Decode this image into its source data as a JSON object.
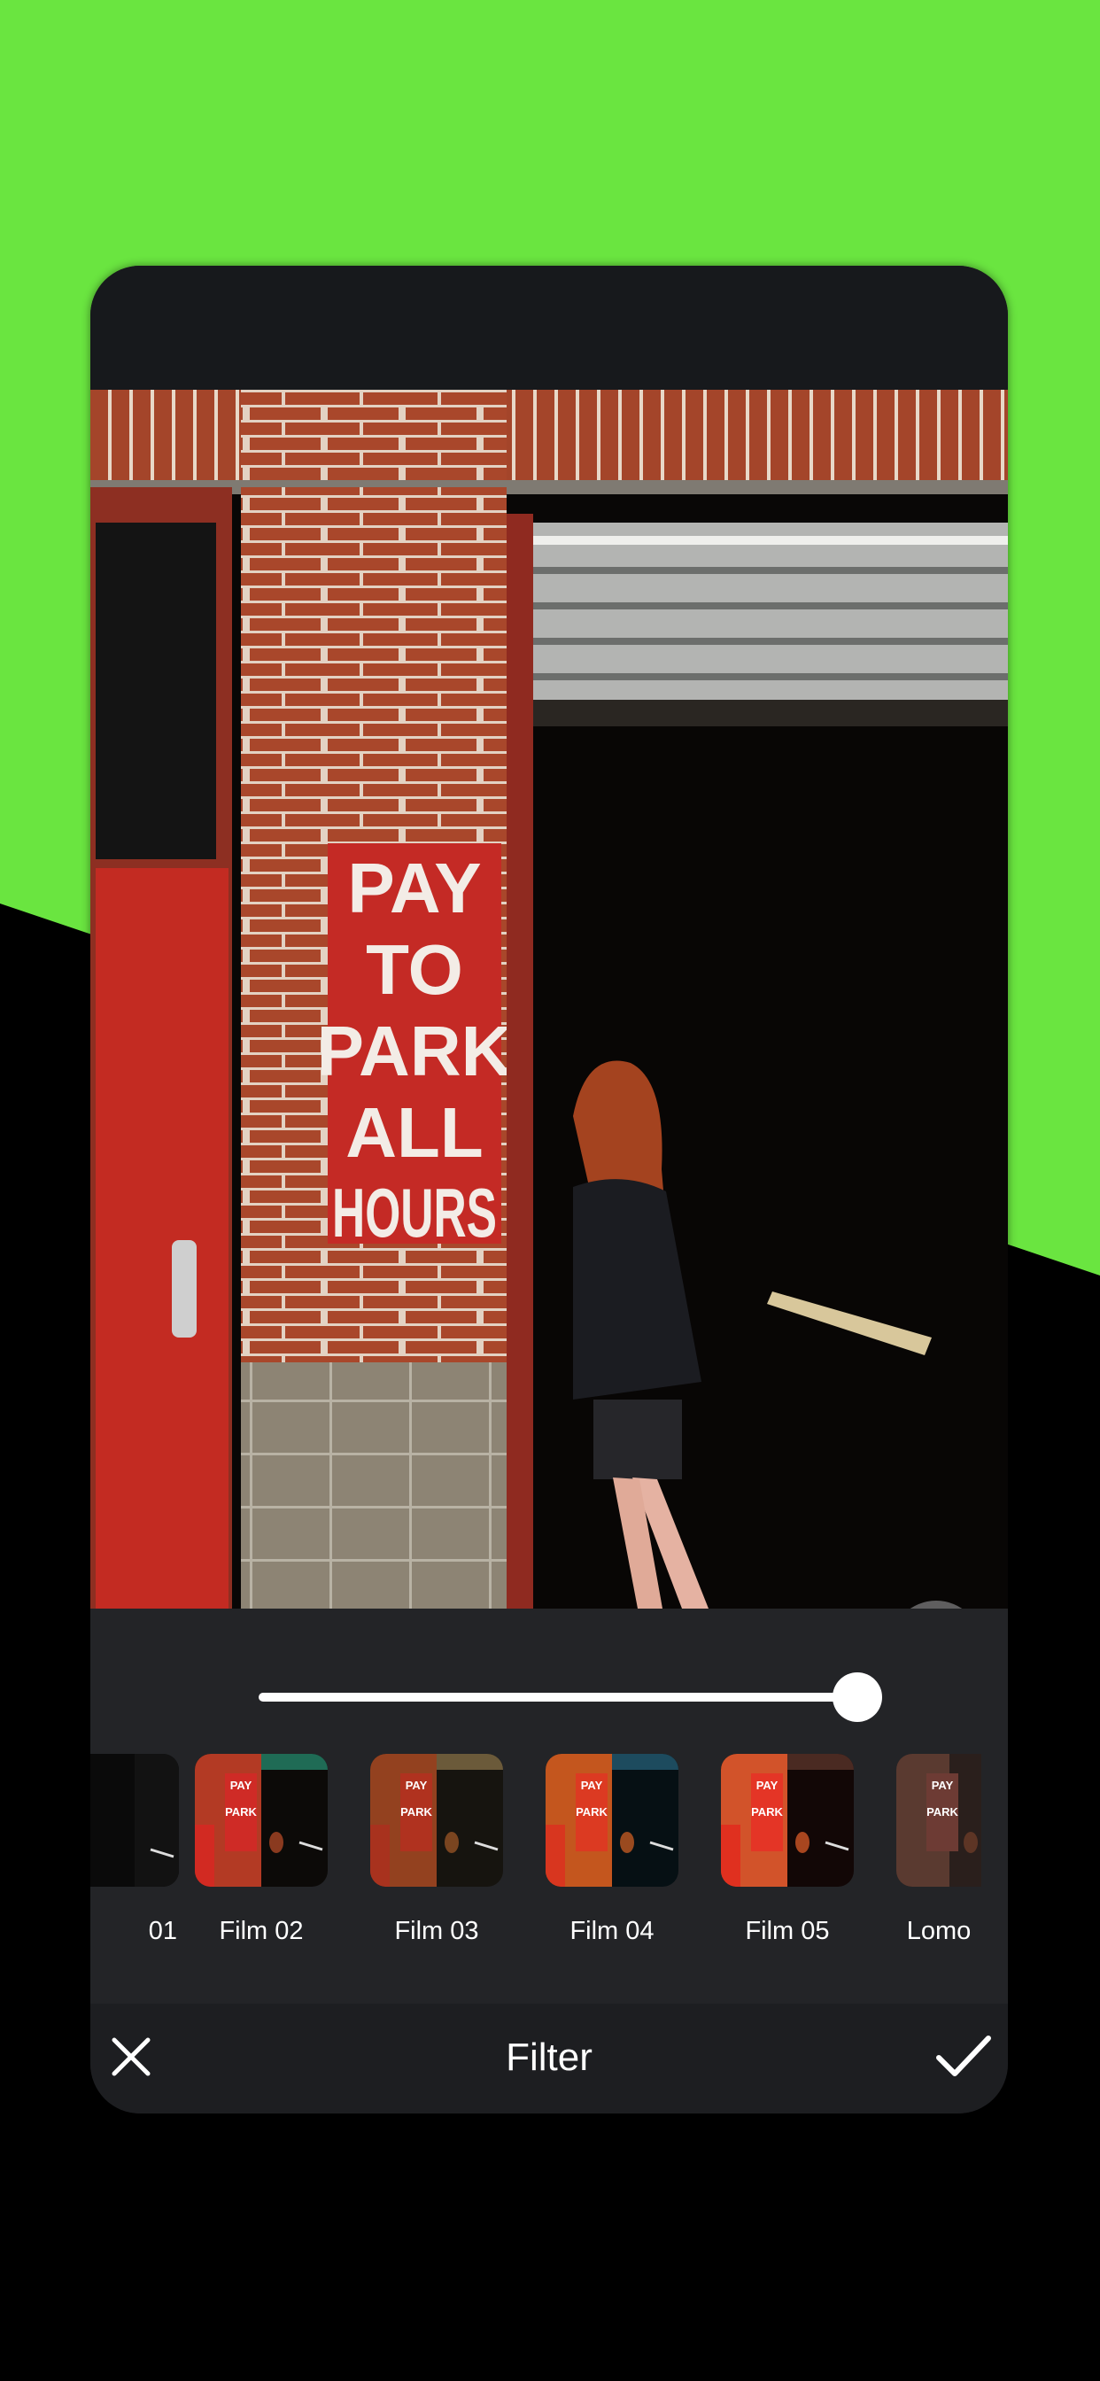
{
  "colors": {
    "background_green": "#6ae540",
    "background_black": "#000000",
    "panel": "#232427",
    "action_bar": "#1d1e21",
    "accent_white": "#ffffff"
  },
  "photo": {
    "sign_lines": [
      "PAY",
      "TO",
      "PARK",
      "ALL",
      "HOURS"
    ]
  },
  "compare_button": {
    "icon": "compare-split-icon"
  },
  "intensity_slider": {
    "value_percent": 100
  },
  "filters": [
    {
      "label": "01",
      "tint": "#3b3f44"
    },
    {
      "label": "Film 02",
      "tint": "#1f6b55"
    },
    {
      "label": "Film 03",
      "tint": "#6b5a3a"
    },
    {
      "label": "Film 04",
      "tint": "#1d4b5e"
    },
    {
      "label": "Film 05",
      "tint": "#4a2a22"
    },
    {
      "label": "Lomo",
      "tint": "#3a2b26"
    }
  ],
  "action_bar": {
    "title": "Filter",
    "close_icon": "close-icon",
    "confirm_icon": "checkmark-icon"
  }
}
